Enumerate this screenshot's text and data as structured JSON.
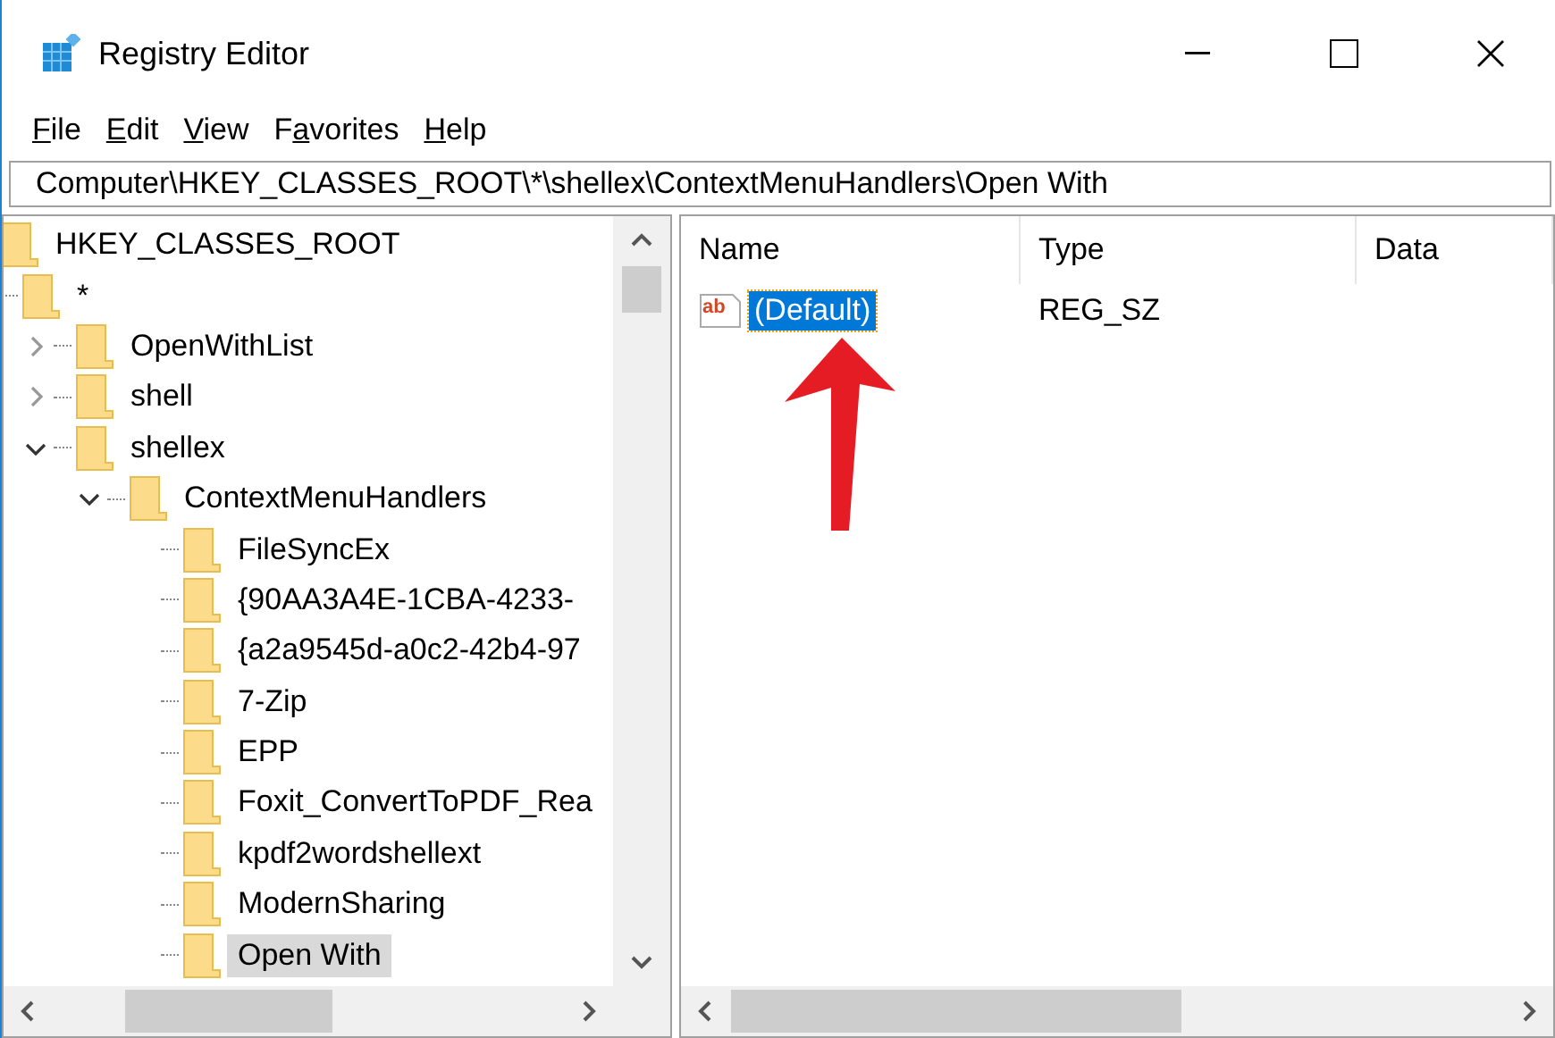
{
  "window": {
    "title": "Registry Editor"
  },
  "menu": [
    {
      "access_key": "F",
      "rest": "ile"
    },
    {
      "access_key": "E",
      "rest": "dit"
    },
    {
      "access_key": "V",
      "rest": "iew"
    },
    {
      "before": "F",
      "access_key": "a",
      "rest": "vorites"
    },
    {
      "access_key": "H",
      "rest": "elp"
    }
  ],
  "address": "Computer\\HKEY_CLASSES_ROOT\\*\\shellex\\ContextMenuHandlers\\Open With",
  "tree": [
    {
      "label": "HKEY_CLASSES_ROOT",
      "selected": false,
      "children": [
        {
          "label": "*",
          "selected": false,
          "children": [
            {
              "label": "OpenWithList",
              "selected": false,
              "expanded": false
            },
            {
              "label": "shell",
              "selected": false,
              "expanded": false
            },
            {
              "label": "shellex",
              "selected": false,
              "expanded": true,
              "children": [
                {
                  "label": "ContextMenuHandlers",
                  "selected": false,
                  "expanded": true,
                  "children": [
                    {
                      "label": "FileSyncEx",
                      "selected": false
                    },
                    {
                      "label": "{90AA3A4E-1CBA-4233-",
                      "selected": false
                    },
                    {
                      "label": "{a2a9545d-a0c2-42b4-97",
                      "selected": false
                    },
                    {
                      "label": "7-Zip",
                      "selected": false
                    },
                    {
                      "label": "EPP",
                      "selected": false
                    },
                    {
                      "label": "Foxit_ConvertToPDF_Rea",
                      "selected": false
                    },
                    {
                      "label": "kpdf2wordshellext",
                      "selected": false
                    },
                    {
                      "label": "ModernSharing",
                      "selected": false
                    },
                    {
                      "label": "Open With",
                      "selected": true
                    }
                  ]
                }
              ]
            }
          ]
        }
      ]
    }
  ],
  "values": {
    "columns": [
      "Name",
      "Type",
      "Data"
    ],
    "rows": [
      {
        "icon_text": "ab",
        "name": "(Default)",
        "type": "REG_SZ",
        "selected": true
      }
    ]
  }
}
